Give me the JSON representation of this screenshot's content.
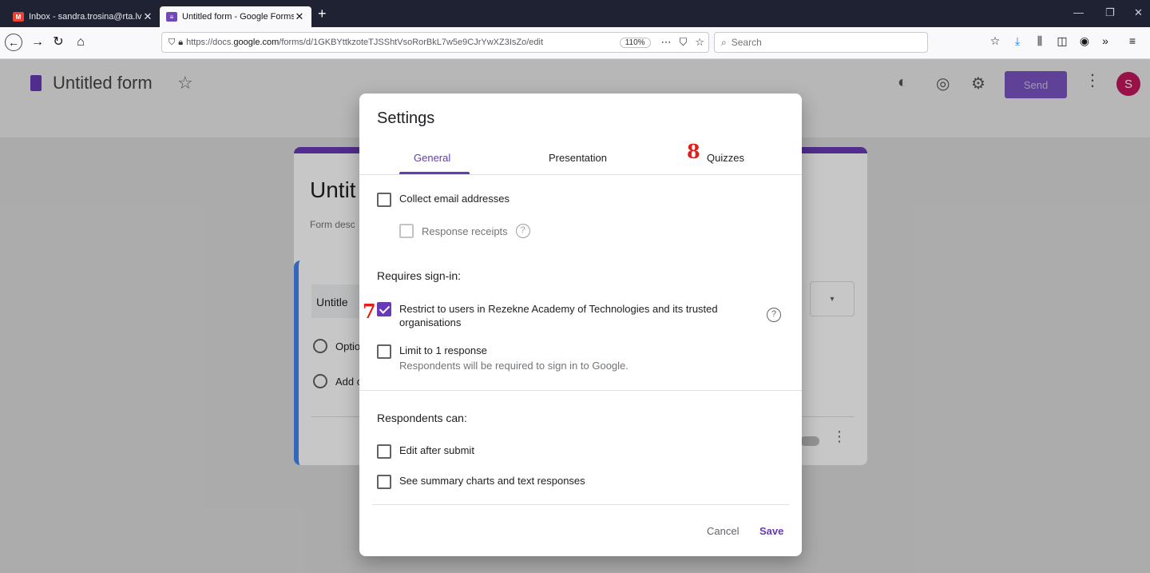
{
  "browser": {
    "tabs": [
      {
        "title": "Inbox - sandra.trosina@rta.lv -",
        "favicon": "gmail-icon",
        "active": false
      },
      {
        "title": "Untitled form - Google Forms",
        "favicon": "forms-icon",
        "active": true
      }
    ],
    "new_tab": "+",
    "url_prefix": "https://docs.",
    "url_domain": "google.com",
    "url_suffix": "/forms/d/1GKBYttkzoteTJSShtVsoRorBkL7w5e9CJrYwXZ3IsZo/edit",
    "zoom": "110%",
    "search_placeholder": "Search"
  },
  "forms": {
    "doc_title": "Untitled form",
    "send_label": "Send",
    "avatar_letter": "S",
    "card_title": "Untit",
    "card_desc": "Form desc",
    "question_title": "Untitle",
    "option_1": "Optio",
    "option_2": "Add c"
  },
  "dialog": {
    "title": "Settings",
    "tabs": {
      "general": "General",
      "presentation": "Presentation",
      "quizzes": "Quizzes"
    },
    "annotations": {
      "quizzes": "8",
      "restrict": "7"
    },
    "collect_email": "Collect email addresses",
    "response_receipts": "Response receipts",
    "requires_signin": "Requires sign-in:",
    "restrict_label": "Restrict to users in Rezekne Academy of Technologies and its trusted organisations",
    "limit_label": "Limit to 1 response",
    "limit_sub": "Respondents will be required to sign in to Google.",
    "respondents_can": "Respondents can:",
    "edit_after": "Edit after submit",
    "see_summary": "See summary charts and text responses",
    "cancel": "Cancel",
    "save": "Save",
    "checkboxes": {
      "collect_email": false,
      "response_receipts": false,
      "restrict": true,
      "limit": false,
      "edit_after": false,
      "see_summary": false
    }
  },
  "colors": {
    "accent": "#673ab7",
    "annotation": "#e0201a"
  }
}
